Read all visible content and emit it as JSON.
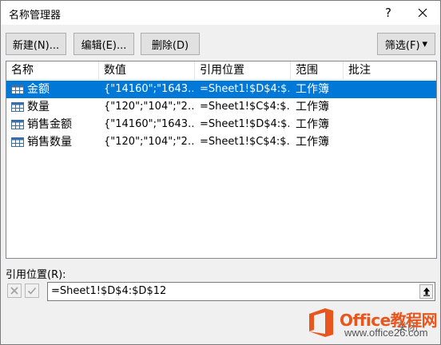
{
  "dialog": {
    "title": "名称管理器",
    "help_glyph": "?",
    "close_glyph": "✕"
  },
  "toolbar": {
    "new_label": "新建(N)...",
    "edit_label": "编辑(E)...",
    "delete_label": "删除(D)",
    "filter_label": "筛选(F)",
    "filter_arrow": "▾"
  },
  "table": {
    "headers": [
      "名称",
      "数值",
      "引用位置",
      "范围",
      "批注"
    ],
    "rows": [
      {
        "name": "金额",
        "value": "{\"14160\";\"1643…",
        "ref": "=Sheet1!$D$4:$…",
        "scope": "工作簿",
        "comment": "",
        "selected": true
      },
      {
        "name": "数量",
        "value": "{\"120\";\"104\";\"2…",
        "ref": "=Sheet1!$C$4:$…",
        "scope": "工作簿",
        "comment": "",
        "selected": false
      },
      {
        "name": "销售金额",
        "value": "{\"14160\";\"1643…",
        "ref": "=Sheet1!$D$4:$…",
        "scope": "工作簿",
        "comment": "",
        "selected": false
      },
      {
        "name": "销售数量",
        "value": "{\"120\";\"104\";\"2…",
        "ref": "=Sheet1!$C$4:$…",
        "scope": "工作簿",
        "comment": "",
        "selected": false
      }
    ]
  },
  "reference": {
    "label": "引用位置(R):",
    "value": "=Sheet1!$D$4:$D$12"
  },
  "footer": {
    "close_label": "关闭"
  },
  "watermark": {
    "brand": "Office教程网",
    "url": "www.office26.com"
  },
  "colors": {
    "selection": "#0078d7",
    "watermark_orange": "#e8561d"
  }
}
